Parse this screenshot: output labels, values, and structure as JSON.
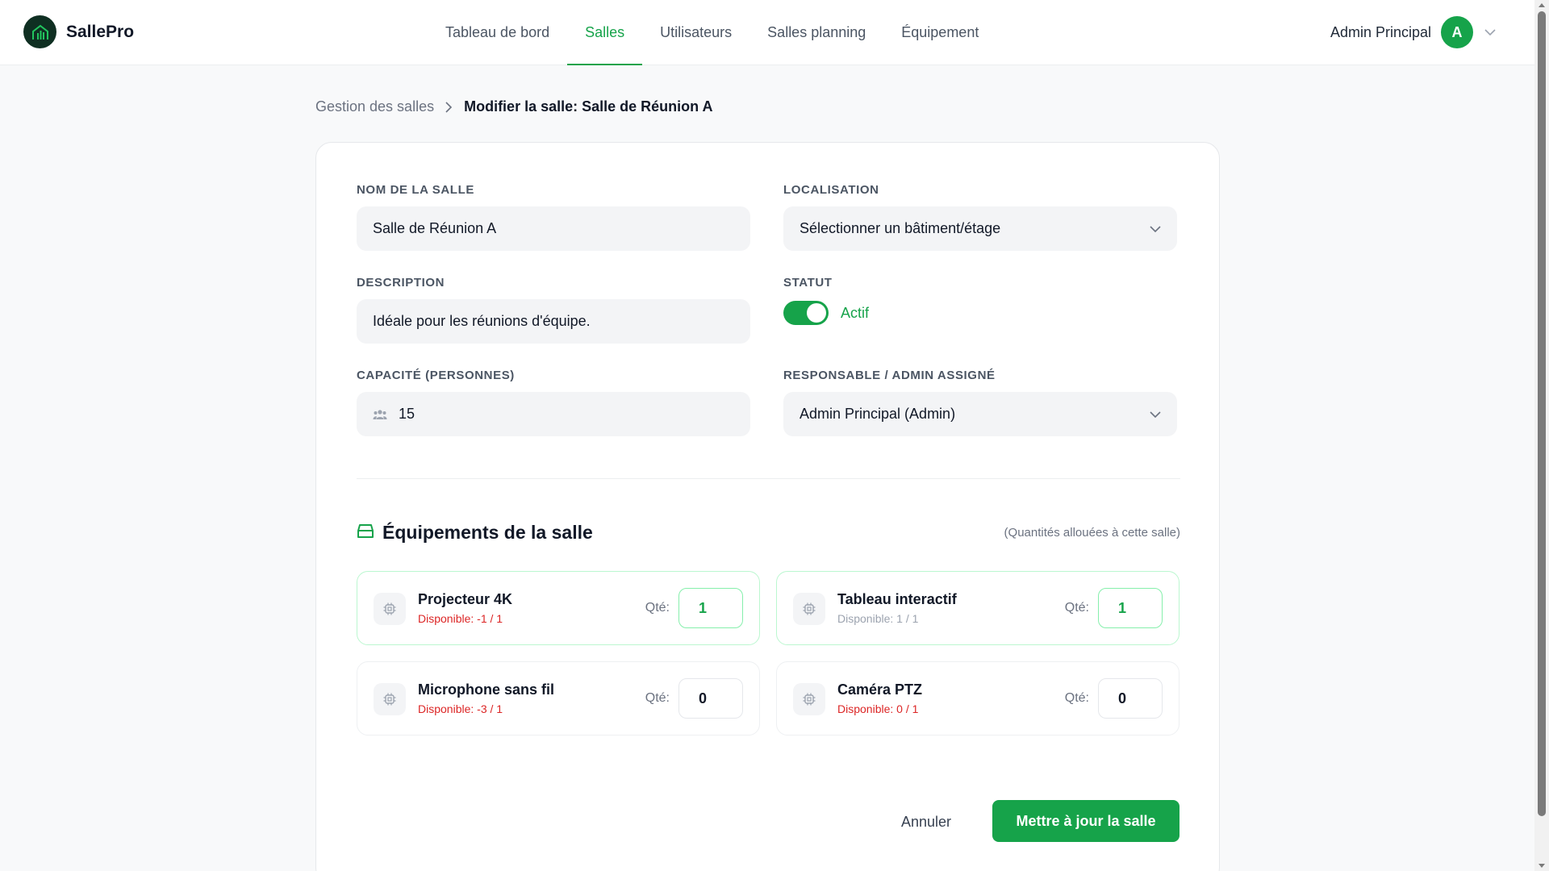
{
  "app": {
    "name": "SallePro",
    "logo_icon": "building-chart-icon"
  },
  "nav": {
    "items": [
      {
        "label": "Tableau de bord",
        "active": false
      },
      {
        "label": "Salles",
        "active": true
      },
      {
        "label": "Utilisateurs",
        "active": false
      },
      {
        "label": "Salles planning",
        "active": false
      },
      {
        "label": "Équipement",
        "active": false
      }
    ]
  },
  "user": {
    "name": "Admin Principal",
    "initial": "A"
  },
  "breadcrumb": {
    "parent": "Gestion des salles",
    "current": "Modifier la salle: Salle de Réunion A"
  },
  "form": {
    "name": {
      "label": "Nom de la salle",
      "value": "Salle de Réunion A"
    },
    "location": {
      "label": "Localisation",
      "value": "Sélectionner un bâtiment/étage"
    },
    "description": {
      "label": "Description",
      "value": "Idéale pour les réunions d'équipe."
    },
    "status": {
      "label": "Statut",
      "value": "Actif",
      "enabled": true
    },
    "capacity": {
      "label": "Capacité (personnes)",
      "value": "15"
    },
    "manager": {
      "label": "Responsable / Admin assigné",
      "value": "Admin Principal (Admin)"
    }
  },
  "equipment": {
    "title": "Équipements de la salle",
    "note": "(Quantités allouées à cette salle)",
    "qty_label": "Qté:",
    "items": [
      {
        "name": "Projecteur 4K",
        "availability": "Disponible: -1 / 1",
        "qty": "1"
      },
      {
        "name": "Tableau interactif",
        "availability": "Disponible: 1 / 1",
        "qty": "1"
      },
      {
        "name": "Microphone sans fil",
        "availability": "Disponible: -3 / 1",
        "qty": "0"
      },
      {
        "name": "Caméra PTZ",
        "availability": "Disponible: 0 / 1",
        "qty": "0"
      }
    ]
  },
  "actions": {
    "cancel": "Annuler",
    "submit": "Mettre à jour la salle"
  },
  "colors": {
    "accent": "#16a34a",
    "danger": "#dc2626",
    "logo_bg": "#0f2f22"
  }
}
